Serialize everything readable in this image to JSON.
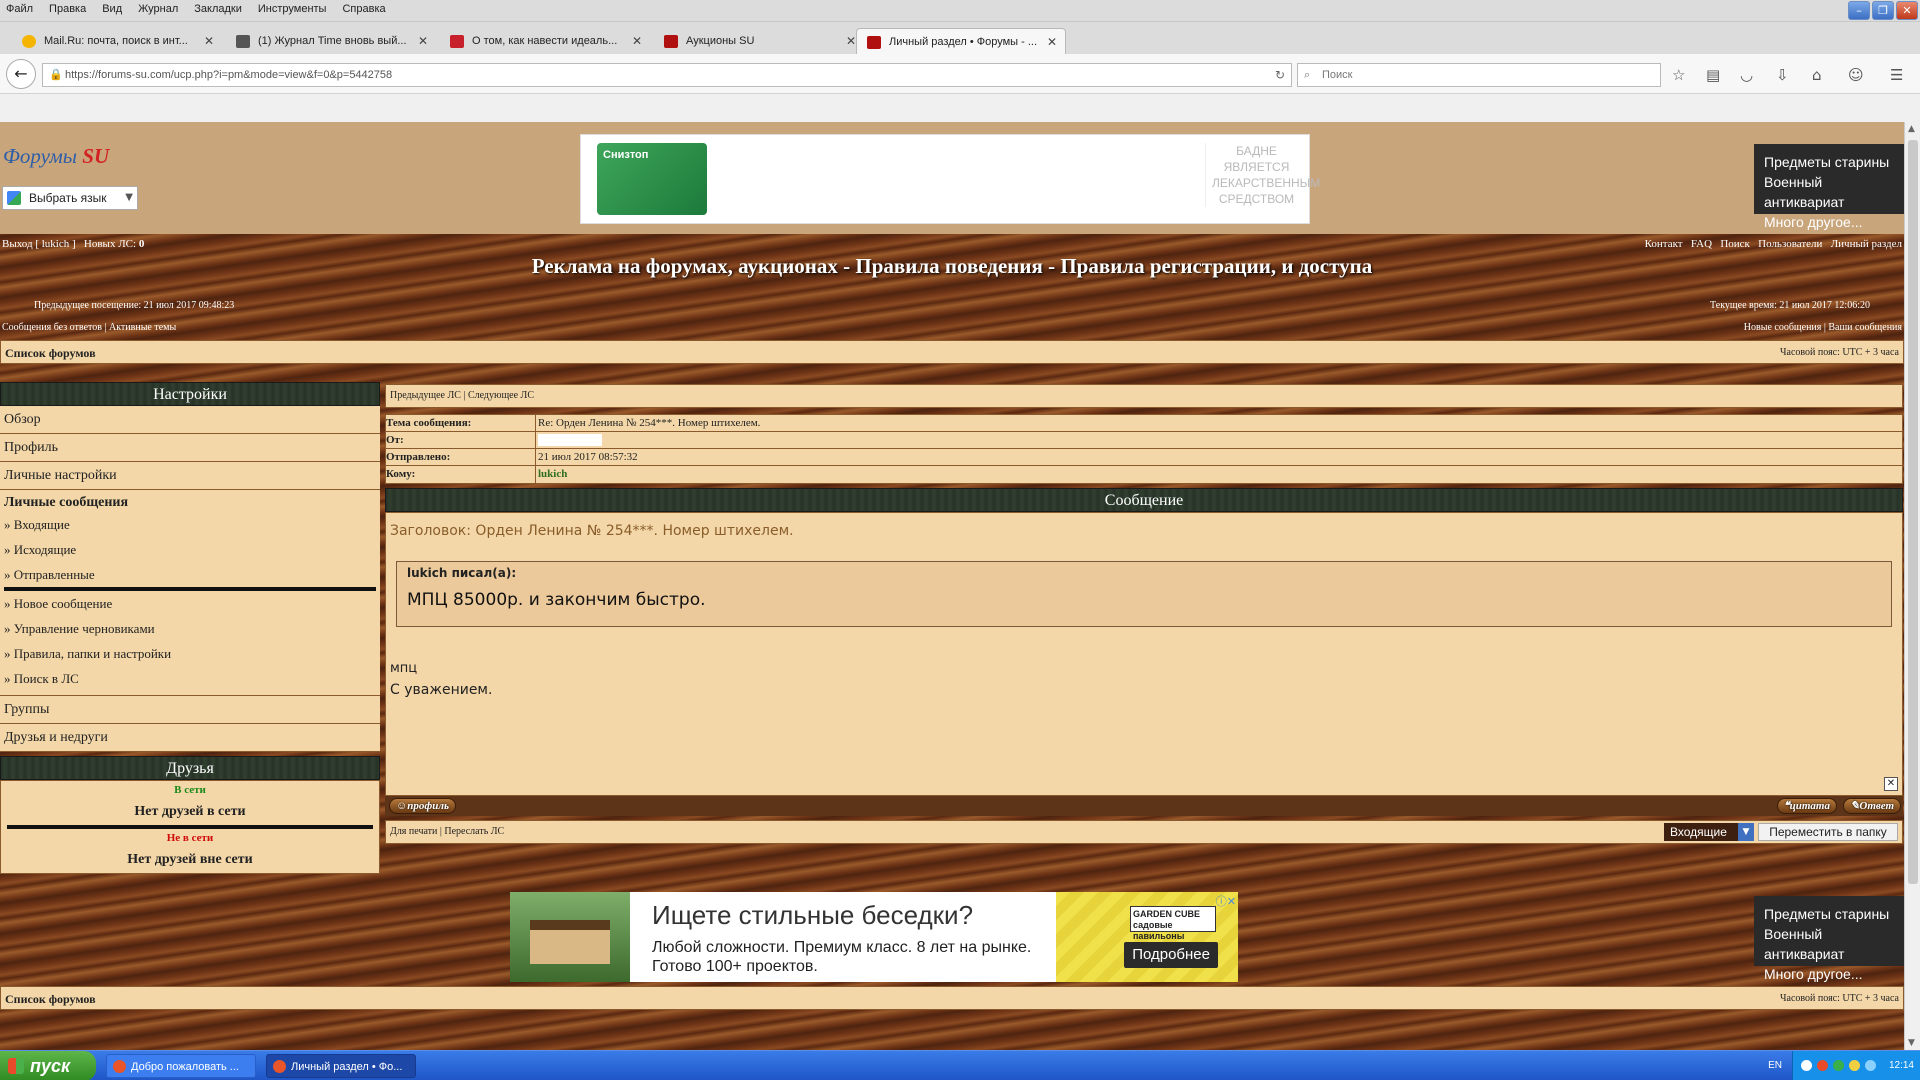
{
  "browser": {
    "menu": [
      "Файл",
      "Правка",
      "Вид",
      "Журнал",
      "Закладки",
      "Инструменты",
      "Справка"
    ],
    "tabs": [
      {
        "title": "Mail.Ru: почта, поиск в инт..."
      },
      {
        "title": "(1) Журнал Time вновь вый..."
      },
      {
        "title": "О том, как навести идеаль..."
      },
      {
        "title": "Аукционы SU"
      },
      {
        "title": "Личный раздел • Форумы - ..."
      }
    ],
    "url": "https://forums-su.com/ucp.php?i=pm&mode=view&f=0&p=5442758",
    "search_placeholder": "Поиск",
    "icons": [
      "back-icon",
      "lock-icon",
      "reload-icon",
      "star-icon",
      "reader-icon",
      "pocket-icon",
      "download-icon",
      "home-icon",
      "chat-icon",
      "menu-icon"
    ]
  },
  "header": {
    "logo_text": "Форумы",
    "logo_accent": "SU",
    "lang_button": "Выбрать язык",
    "ad_top": {
      "brand": "Снизтоп",
      "disclaimer": "БАДНЕ ЯВЛЯЕТСЯ ЛЕКАРСТВЕННЫМ СРЕДСТВОМ"
    },
    "antique_ad": [
      "Предметы старины",
      "Военный антиквариат",
      "Много другое..."
    ]
  },
  "userbar": {
    "left": "Выход [ lukich ]",
    "new_pm_label": "Новых ЛС:",
    "new_pm_count": "0",
    "right": [
      "Контакт",
      "FAQ",
      "Поиск",
      "Пользователи",
      "Личный раздел"
    ]
  },
  "banner": "Реклама на форумах, аукционах - Правила поведения - Правила регистрации, и доступа",
  "visits": {
    "previous": "Предыдущее посещение: 21 июл 2017 09:48:23",
    "current": "Текущее время: 21 июл 2017 12:06:20"
  },
  "quicklinks": {
    "left": "Сообщения без ответов  |  Активные темы",
    "right": "Новые сообщения | Ваши сообщения"
  },
  "forumbar": {
    "label": "Список форумов",
    "timezone": "Часовой пояс: UTC + 3 часа"
  },
  "sidebar": {
    "title": "Настройки",
    "items": [
      "Обзор",
      "Профиль",
      "Личные настройки"
    ],
    "pm_title": "Личные сообщения",
    "pm_items": [
      "» Входящие",
      "» Исходящие",
      "» Отправленные",
      "» Новое сообщение",
      "» Управление черновиками",
      "» Правила, папки и настройки",
      "» Поиск в ЛС"
    ],
    "items2": [
      "Группы",
      "Друзья и недруги"
    ],
    "friends_title": "Друзья",
    "online_label": "В сети",
    "online_none": "Нет друзей в сети",
    "offline_label": "Не в сети",
    "offline_none": "Нет друзей вне сети"
  },
  "pm": {
    "prevnext": "Предыдущее ЛС  |  Следующее ЛС",
    "subject_label": "Тема сообщения:",
    "subject": "Re: Орден Ленина № 254***. Номер штихелем.",
    "from_label": "От:",
    "sent_label": "Отправлено:",
    "sent": "21 июл 2017 08:57:32",
    "to_label": "Кому:",
    "to": "lukich",
    "message_title": "Сообщение",
    "heading": "Заголовок: Орден Ленина № 254***. Номер штихелем.",
    "quote_author": "lukich писал(а):",
    "quote_text": "МПЦ 85000р. и закончим быстро.",
    "body_line1": "мпц",
    "body_line2": "С уважением.",
    "btn_profile": "профиль",
    "btn_quote": "цитата",
    "btn_reply": "Ответ",
    "print_links": "Для печати  |  Переслать ЛС",
    "folder_value": "Входящие",
    "move_button": "Переместить в папку"
  },
  "bottom_ad": {
    "headline": "Ищете стильные беседки?",
    "text": "Любой сложности. Премиум класс. 8 лет на рынке. Готово 100+ проектов.",
    "logo": "GARDEN CUBE садовые павильоны",
    "cta": "Подробнее"
  },
  "taskbar": {
    "start": "пуск",
    "tasks": [
      "Добро пожаловать ...",
      "Личный раздел • Фо..."
    ],
    "lang": "EN",
    "time": "12:14"
  }
}
